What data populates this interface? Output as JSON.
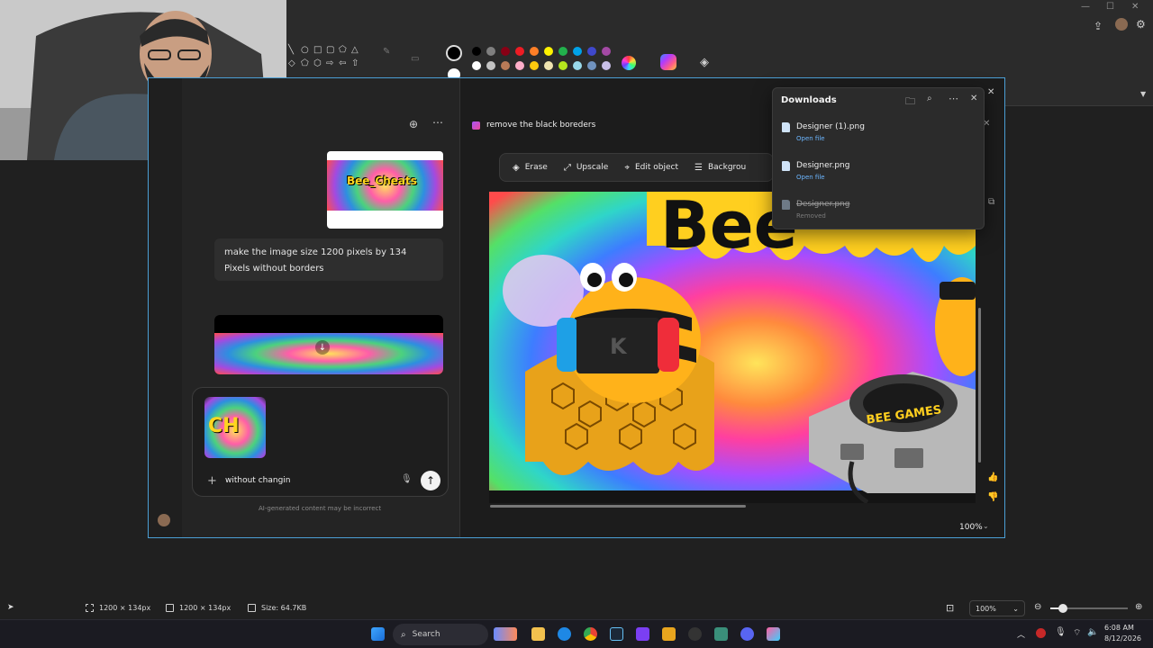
{
  "paint": {
    "window_controls": [
      "—",
      "☐",
      "✕"
    ],
    "statusbar": {
      "selection_size": "1200 × 134px",
      "image_size": "1200 × 134px",
      "file_size": "Size: 64.7KB",
      "zoom": "100%"
    }
  },
  "designer": {
    "chat": {
      "user_message": "make the image size 1200 pixels by 134 Pixels without borders",
      "thumbnail_text": "Bee_Cheats",
      "attachment_text": "CH",
      "input_value": "without changin",
      "disclaimer": "AI-generated content may be incorrect"
    },
    "canvas": {
      "title": "remove the black boreders",
      "tools": [
        {
          "icon": "erase-icon",
          "label": "Erase"
        },
        {
          "icon": "upscale-icon",
          "label": "Upscale"
        },
        {
          "icon": "edit-object-icon",
          "label": "Edit object"
        },
        {
          "icon": "background-icon",
          "label": "Backgrou"
        }
      ],
      "zoom": "100%",
      "image_text": {
        "headline": "Bee",
        "console_label": "BEE GAMES",
        "screen_letter": "K"
      }
    }
  },
  "downloads": {
    "title": "Downloads",
    "items": [
      {
        "name": "Designer (1).png",
        "action": "Open file",
        "removed": false
      },
      {
        "name": "Designer.png",
        "action": "Open file",
        "removed": false
      },
      {
        "name": "Designer.png",
        "action": "Removed",
        "removed": true
      }
    ]
  },
  "taskbar": {
    "search_label": "Search",
    "time": "6:08 AM",
    "date": "8/12/2026"
  },
  "colors": {
    "accent": "#4b9fd5",
    "link": "#6cb6ff",
    "window_bg": "#1f1f1f"
  }
}
